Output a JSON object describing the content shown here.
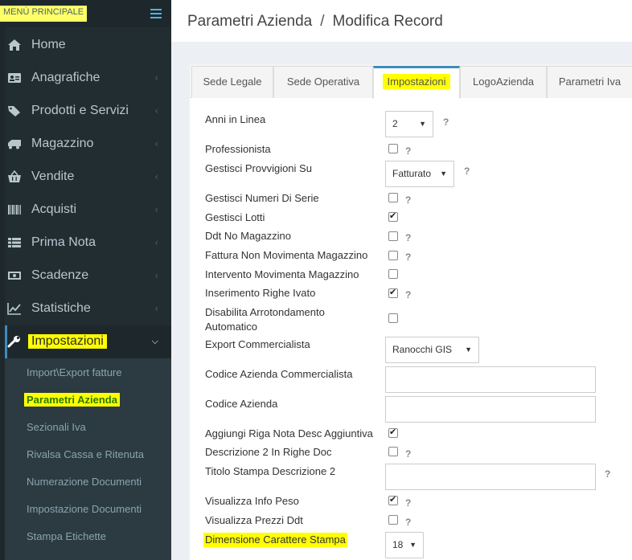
{
  "sidebar": {
    "header_title": "MENÙ PRINCIPALE",
    "items": [
      {
        "label": "Home",
        "icon": "home-icon"
      },
      {
        "label": "Anagrafiche",
        "icon": "address-card-icon"
      },
      {
        "label": "Prodotti e Servizi",
        "icon": "tags-icon"
      },
      {
        "label": "Magazzino",
        "icon": "truck-icon"
      },
      {
        "label": "Vendite",
        "icon": "shopping-basket-icon"
      },
      {
        "label": "Acquisti",
        "icon": "barcode-icon"
      },
      {
        "label": "Prima Nota",
        "icon": "list-icon"
      },
      {
        "label": "Scadenze",
        "icon": "money-icon"
      },
      {
        "label": "Statistiche",
        "icon": "line-chart-icon"
      },
      {
        "label": "Impostazioni",
        "icon": "wrench-icon"
      }
    ],
    "sub_items": [
      "Import\\Export fatture",
      "Parametri Azienda",
      "Sezionali Iva",
      "Rivalsa Cassa e Ritenuta",
      "Numerazione Documenti",
      "Impostazione Documenti",
      "Stampa Etichette"
    ]
  },
  "header": {
    "breadcrumb_part1": "Parametri Azienda",
    "breadcrumb_sep": "/",
    "breadcrumb_part2": "Modifica Record"
  },
  "tabs": [
    "Sede Legale",
    "Sede Operativa",
    "Impostazioni",
    "LogoAzienda",
    "Parametri Iva"
  ],
  "help_mark": "?",
  "form": {
    "anni_label": "Anni in Linea",
    "anni_value": "2",
    "professionista_label": "Professionista",
    "provvigioni_label": "Gestisci Provvigioni Su",
    "provvigioni_value": "Fatturato",
    "numeri_serie_label": "Gestisci Numeri Di Serie",
    "lotti_label": "Gestisci Lotti",
    "ddt_label": "Ddt No Magazzino",
    "fattura_label": "Fattura Non Movimenta Magazzino",
    "intervento_label": "Intervento Movimenta Magazzino",
    "righe_ivato_label": "Inserimento Righe Ivato",
    "arrot_label_1": "Disabilita Arrotondamento",
    "arrot_label_2": "Automatico",
    "export_label": "Export Commercialista",
    "export_value": "Ranocchi GIS",
    "cod_comm_label": "Codice Azienda Commercialista",
    "cod_az_label": "Codice Azienda",
    "riga_nota_label": "Aggiungi Riga Nota Desc Aggiuntiva",
    "descr2_label": "Descrizione 2 In Righe Doc",
    "titolo_label": "Titolo Stampa Descrizione 2",
    "peso_label": "Visualizza Info Peso",
    "prezzi_label": "Visualizza Prezzi Ddt",
    "dim_label": "Dimensione Carattere Stampa",
    "dim_value": "18"
  }
}
